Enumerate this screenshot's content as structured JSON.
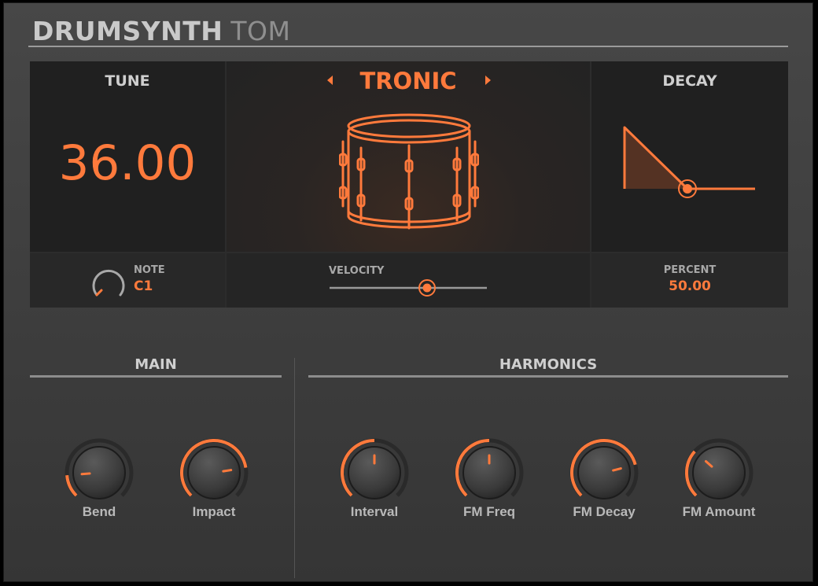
{
  "header": {
    "title_bold": "DRUMSYNTH",
    "title_light": "TOM"
  },
  "display": {
    "tune": {
      "title": "TUNE",
      "value": "36.00"
    },
    "preset": {
      "name": "TRONIC",
      "prev_icon": "left-arrow",
      "next_icon": "right-arrow"
    },
    "decay": {
      "title": "DECAY"
    },
    "note": {
      "label": "NOTE",
      "value": "C1"
    },
    "velocity": {
      "label": "VELOCITY",
      "value": 0.62
    },
    "percent": {
      "label": "PERCENT",
      "value": "50.00"
    }
  },
  "sections": {
    "main": {
      "title": "MAIN",
      "knobs": [
        {
          "label": "Bend",
          "value": 0.15
        },
        {
          "label": "Impact",
          "value": 0.8
        }
      ]
    },
    "harmonics": {
      "title": "HARMONICS",
      "knobs": [
        {
          "label": "Interval",
          "value": 0.5
        },
        {
          "label": "FM Freq",
          "value": 0.5
        },
        {
          "label": "FM Decay",
          "value": 0.78
        },
        {
          "label": "FM Amount",
          "value": 0.32
        }
      ]
    }
  },
  "colors": {
    "accent": "#ff7a3c",
    "track": "#2a2a2a",
    "label": "#b9b9b9"
  }
}
